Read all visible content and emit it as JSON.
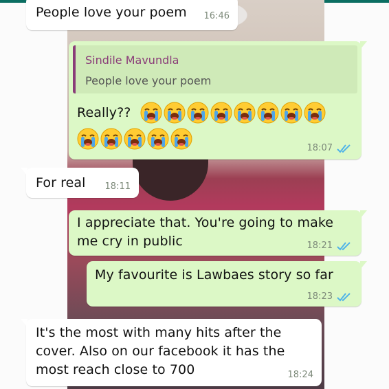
{
  "messages": [
    {
      "text": "People love your poem",
      "time": "16:46"
    },
    {
      "quoted_name": "Sindile Mavundla",
      "quoted_text": "People love your poem",
      "text": "Really??",
      "emoji": "loudly-crying-face",
      "emoji_count": 13,
      "time": "18:07"
    },
    {
      "text": "For real",
      "time": "18:11"
    },
    {
      "lines": [
        "I appreciate that. You're going to make",
        "me cry in public"
      ],
      "time": "18:21"
    },
    {
      "text": "My favourite is Lawbaes story so far",
      "time": "18:23"
    },
    {
      "lines": [
        "It's the most with many hits after the",
        "cover. Also on our facebook it has the",
        "most reach close to 700"
      ],
      "time": "18:24"
    }
  ],
  "colors": {
    "incoming": "#ffffff",
    "outgoing": "#dcf8c6",
    "read_ticks": "#4fb3e8",
    "quote_accent": "#8a3c78"
  }
}
